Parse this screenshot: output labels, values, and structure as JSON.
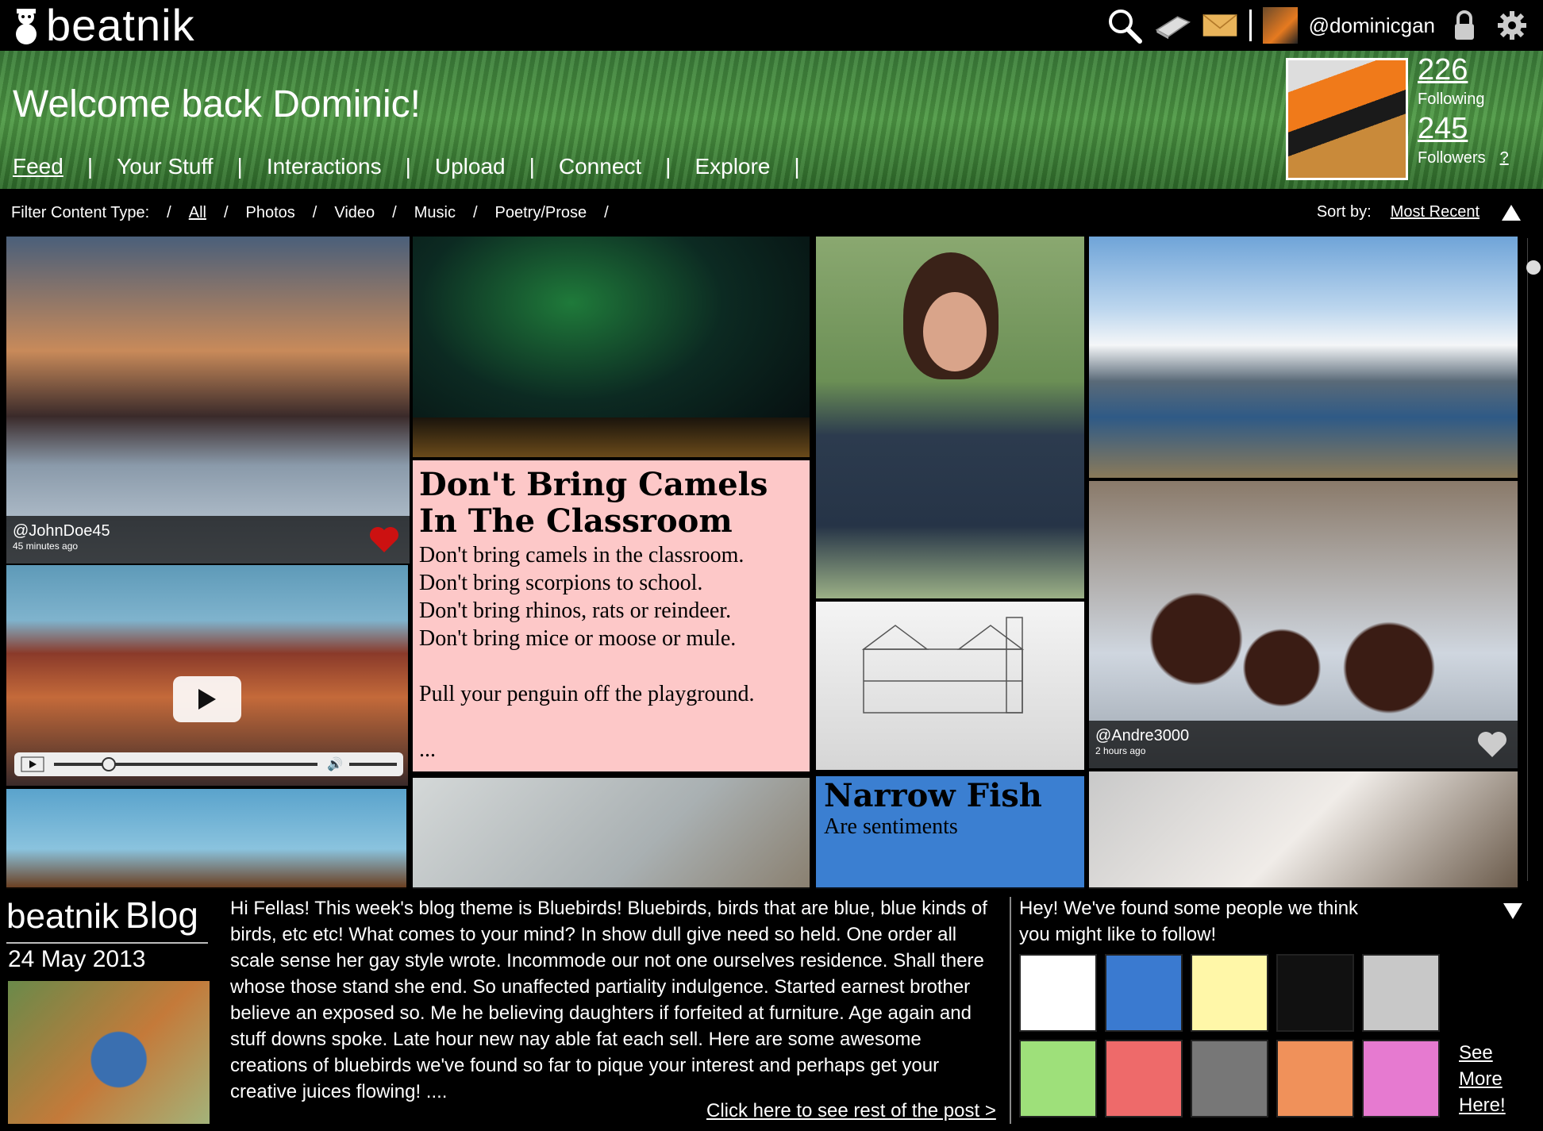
{
  "brand": {
    "name": "beatnik"
  },
  "topbar": {
    "username": "@dominicgan"
  },
  "hero": {
    "welcome": "Welcome back Dominic!",
    "nav": [
      "Feed",
      "Your Stuff",
      "Interactions",
      "Upload",
      "Connect",
      "Explore"
    ],
    "stats": {
      "following_count": "226",
      "following_label": "Following",
      "followers_count": "245",
      "followers_label": "Followers",
      "help": "?"
    }
  },
  "filter": {
    "label": "Filter Content Type:",
    "options": [
      "All",
      "Photos",
      "Video",
      "Music",
      "Poetry/Prose"
    ],
    "sort_label": "Sort by:",
    "sort_value": "Most Recent"
  },
  "feed": {
    "post1": {
      "user": "@JohnDoe45",
      "time": "45 minutes ago"
    },
    "poem": {
      "title": "Don't Bring Camels In The Classroom",
      "body": "Don't bring camels in the classroom.\nDon't bring scorpions to school.\nDon't bring rhinos, rats or reindeer.\nDon't bring mice or moose or mule.\n\nPull your penguin off the playground.\n\n..."
    },
    "narrow": {
      "title": "Narrow Fish",
      "body": "Are sentiments"
    },
    "post2": {
      "user": "@Andre3000",
      "time": "2 hours ago"
    }
  },
  "blog": {
    "title_a": "beatnik",
    "title_b": "Blog",
    "date": "24 May 2013",
    "text": "Hi Fellas! This week's blog theme is Bluebirds! Bluebirds, birds that are blue, blue kinds of birds, etc etc! What comes to your mind? In show dull give need so held. One order all scale sense her gay style wrote. Incommode our not one ourselves residence. Shall there whose those stand she end. So unaffected partiality indulgence. Started earnest brother believe an exposed so. Me he believing daughters if forfeited at furniture. Age again and stuff downs spoke. Late hour new nay able fat each sell. Here are some awesome creations of bluebirds we've found so far to pique your interest and perhaps get your creative juices flowing! ....",
    "more": "Click here to see rest of the post >"
  },
  "suggest": {
    "text": "Hey! We've found some people we think you might like to follow!",
    "see_more": "See\nMore\nHere!"
  },
  "colors": {
    "poem_bg": "#fdc8c8",
    "narrow_bg": "#3b7fd1",
    "heart": "#cc1111"
  }
}
